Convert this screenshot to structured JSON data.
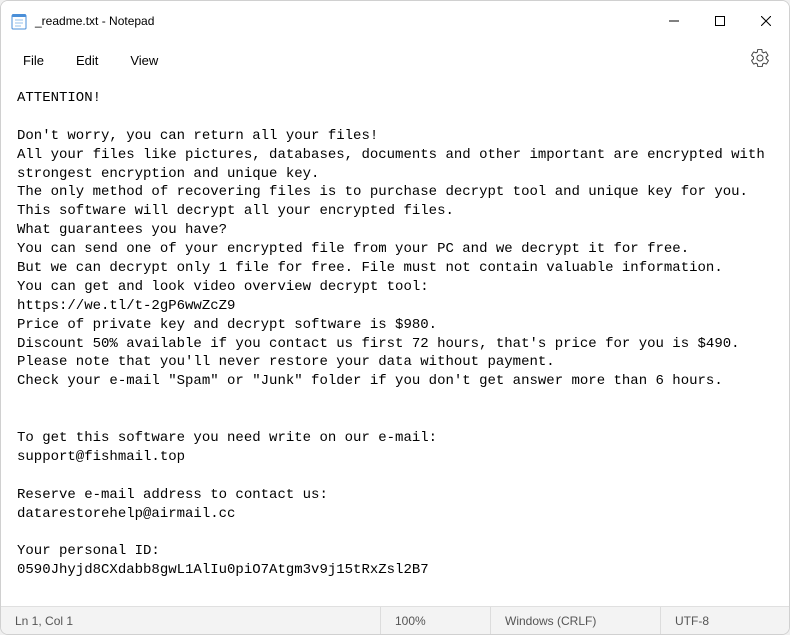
{
  "window": {
    "title": "_readme.txt - Notepad"
  },
  "menu": {
    "file": "File",
    "edit": "Edit",
    "view": "View"
  },
  "content": {
    "text": "ATTENTION!\n\nDon't worry, you can return all your files!\nAll your files like pictures, databases, documents and other important are encrypted with strongest encryption and unique key.\nThe only method of recovering files is to purchase decrypt tool and unique key for you.\nThis software will decrypt all your encrypted files.\nWhat guarantees you have?\nYou can send one of your encrypted file from your PC and we decrypt it for free.\nBut we can decrypt only 1 file for free. File must not contain valuable information.\nYou can get and look video overview decrypt tool:\nhttps://we.tl/t-2gP6wwZcZ9\nPrice of private key and decrypt software is $980.\nDiscount 50% available if you contact us first 72 hours, that's price for you is $490.\nPlease note that you'll never restore your data without payment.\nCheck your e-mail \"Spam\" or \"Junk\" folder if you don't get answer more than 6 hours.\n\n\nTo get this software you need write on our e-mail:\nsupport@fishmail.top\n\nReserve e-mail address to contact us:\ndatarestorehelp@airmail.cc\n\nYour personal ID:\n0590Jhyjd8CXdabb8gwL1AlIu0piO7Atgm3v9j15tRxZsl2B7"
  },
  "statusbar": {
    "position": "Ln 1, Col 1",
    "zoom": "100%",
    "line_ending": "Windows (CRLF)",
    "encoding": "UTF-8"
  }
}
